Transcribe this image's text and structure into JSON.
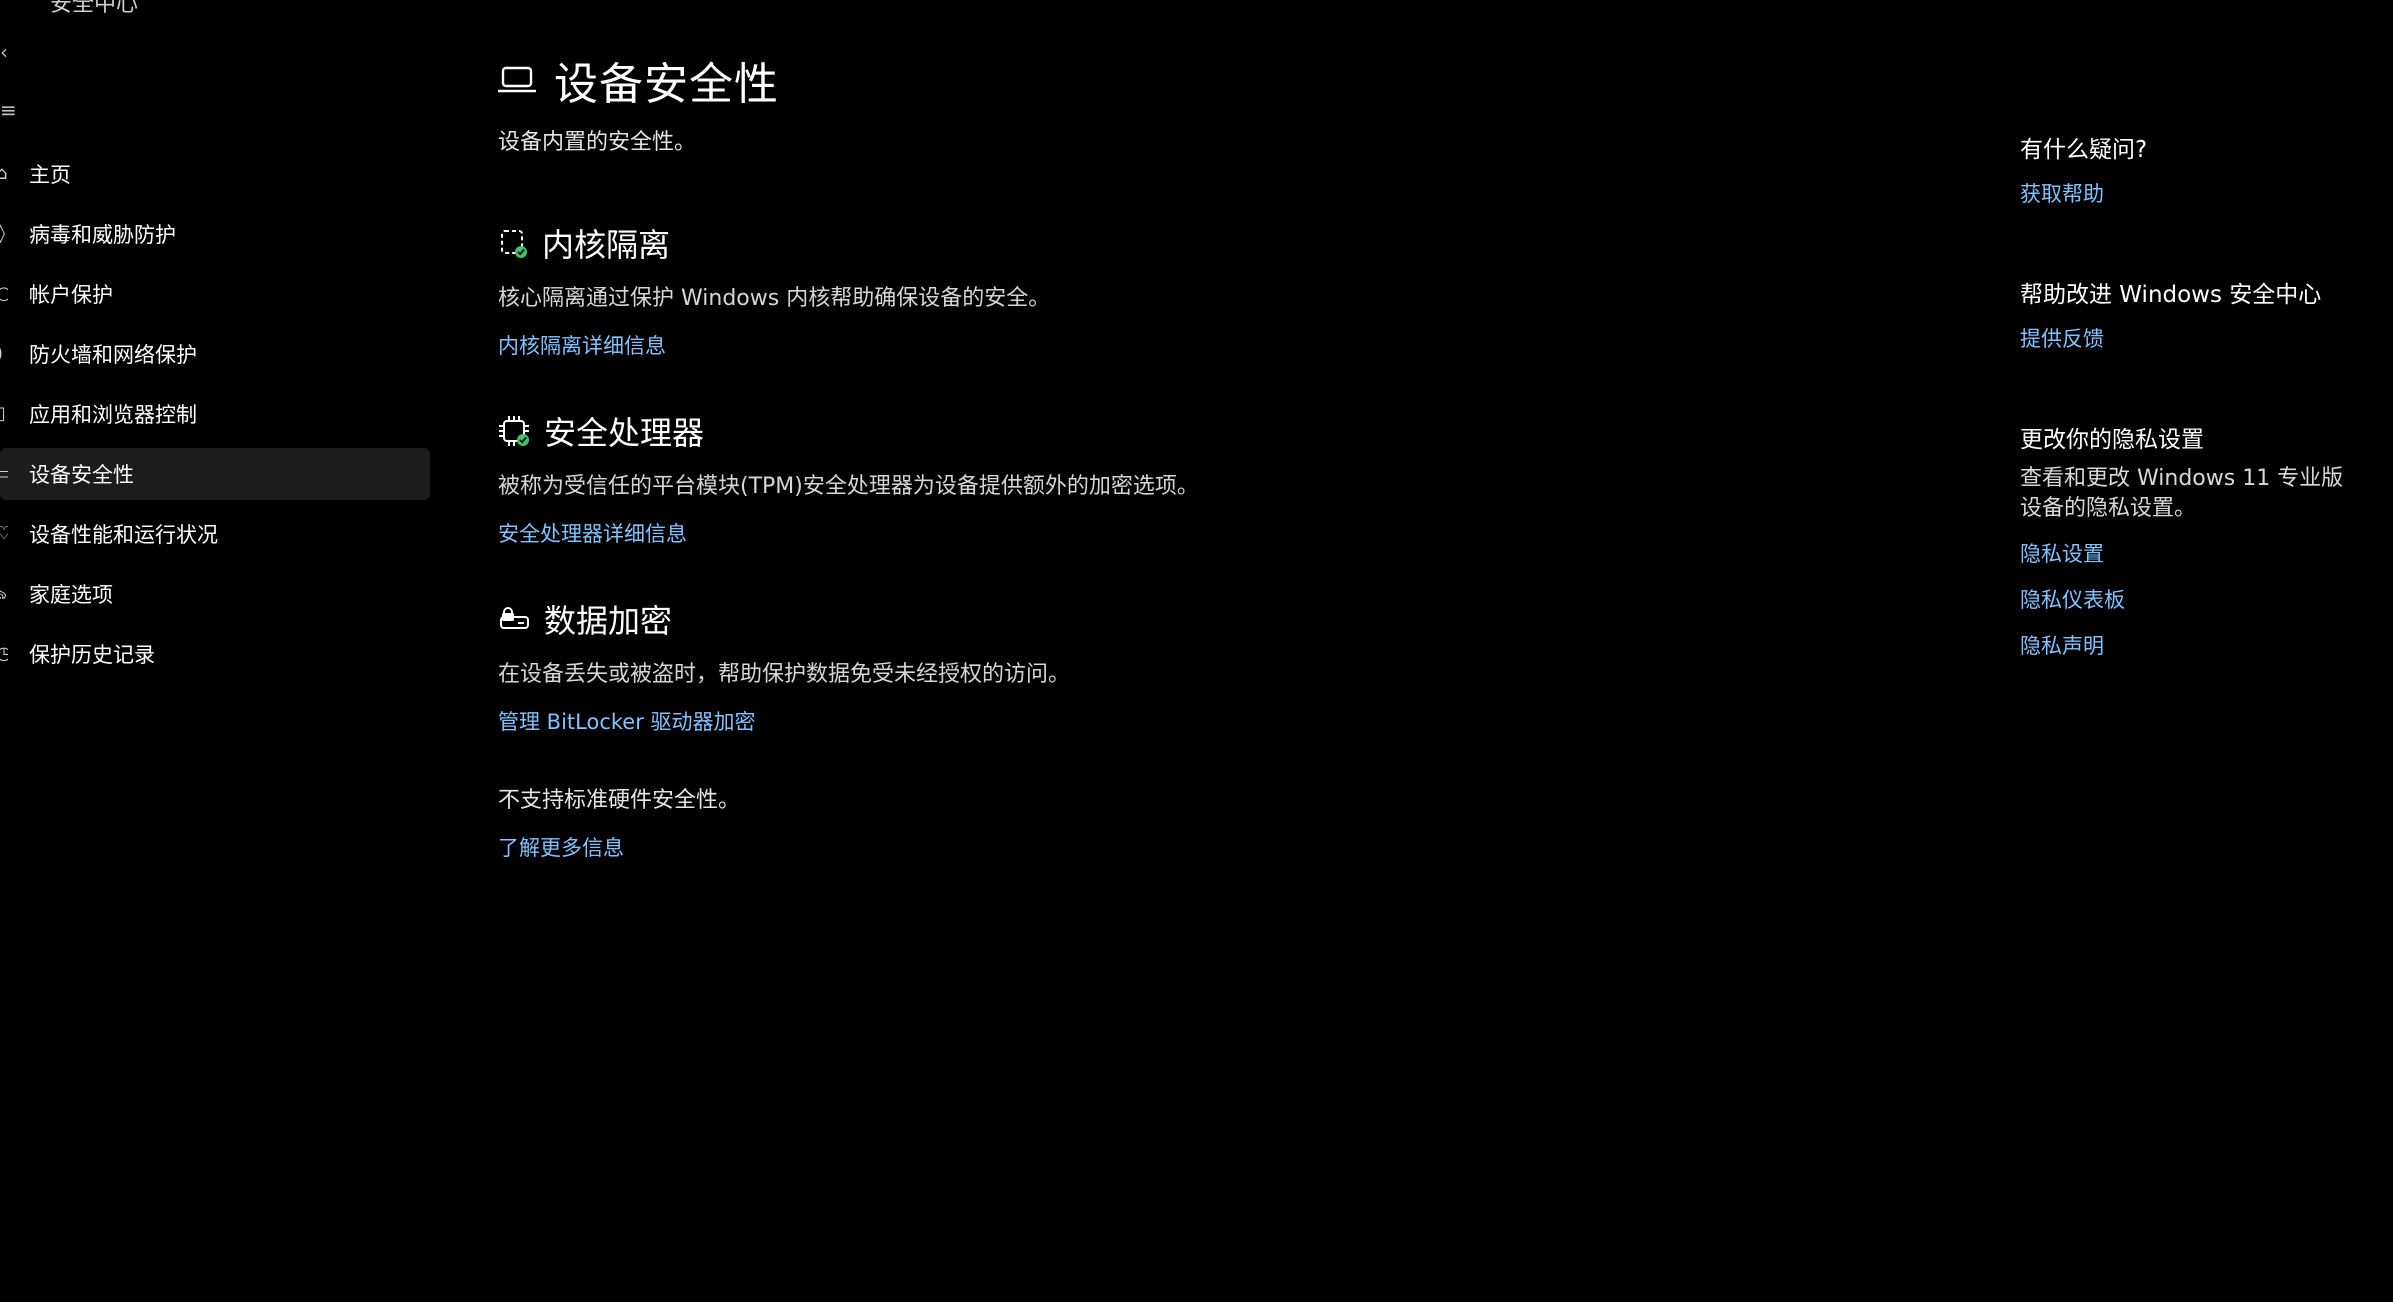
{
  "sidebar": {
    "top_fragment": "安全中心",
    "frag_glyphs": [
      "‹",
      "≡"
    ],
    "items": [
      {
        "label": "主页",
        "active": false
      },
      {
        "label": "病毒和威胁防护",
        "active": false
      },
      {
        "label": "帐户保护",
        "active": false
      },
      {
        "label": "防火墙和网络保护",
        "active": false
      },
      {
        "label": "应用和浏览器控制",
        "active": false
      },
      {
        "label": "设备安全性",
        "active": true
      },
      {
        "label": "设备性能和运行状况",
        "active": false
      },
      {
        "label": "家庭选项",
        "active": false
      },
      {
        "label": "保护历史记录",
        "active": false
      }
    ]
  },
  "main": {
    "title": "设备安全性",
    "subtitle": "设备内置的安全性。",
    "core_isolation": {
      "title": "内核隔离",
      "desc": "核心隔离通过保护 Windows 内核帮助确保设备的安全。",
      "link": "内核隔离详细信息"
    },
    "security_processor": {
      "title": "安全处理器",
      "desc": "被称为受信任的平台模块(TPM)安全处理器为设备提供额外的加密选项。",
      "link": "安全处理器详细信息"
    },
    "data_encryption": {
      "title": "数据加密",
      "desc": "在设备丢失或被盗时，帮助保护数据免受未经授权的访问。",
      "link": "管理 BitLocker 驱动器加密"
    },
    "hardware_status": {
      "desc": "不支持标准硬件安全性。",
      "link": "了解更多信息"
    }
  },
  "right": {
    "questions": {
      "title": "有什么疑问?",
      "link": "获取帮助"
    },
    "improve": {
      "title": "帮助改进 Windows 安全中心",
      "link": "提供反馈"
    },
    "privacy": {
      "title": "更改你的隐私设置",
      "desc": "查看和更改 Windows 11 专业版 设备的隐私设置。",
      "links": [
        "隐私设置",
        "隐私仪表板",
        "隐私声明"
      ]
    }
  },
  "colors": {
    "background": "#000000",
    "link": "#7fc3ff",
    "active_item_bg": "#1c1c1c",
    "status_green": "#3cc46a"
  }
}
